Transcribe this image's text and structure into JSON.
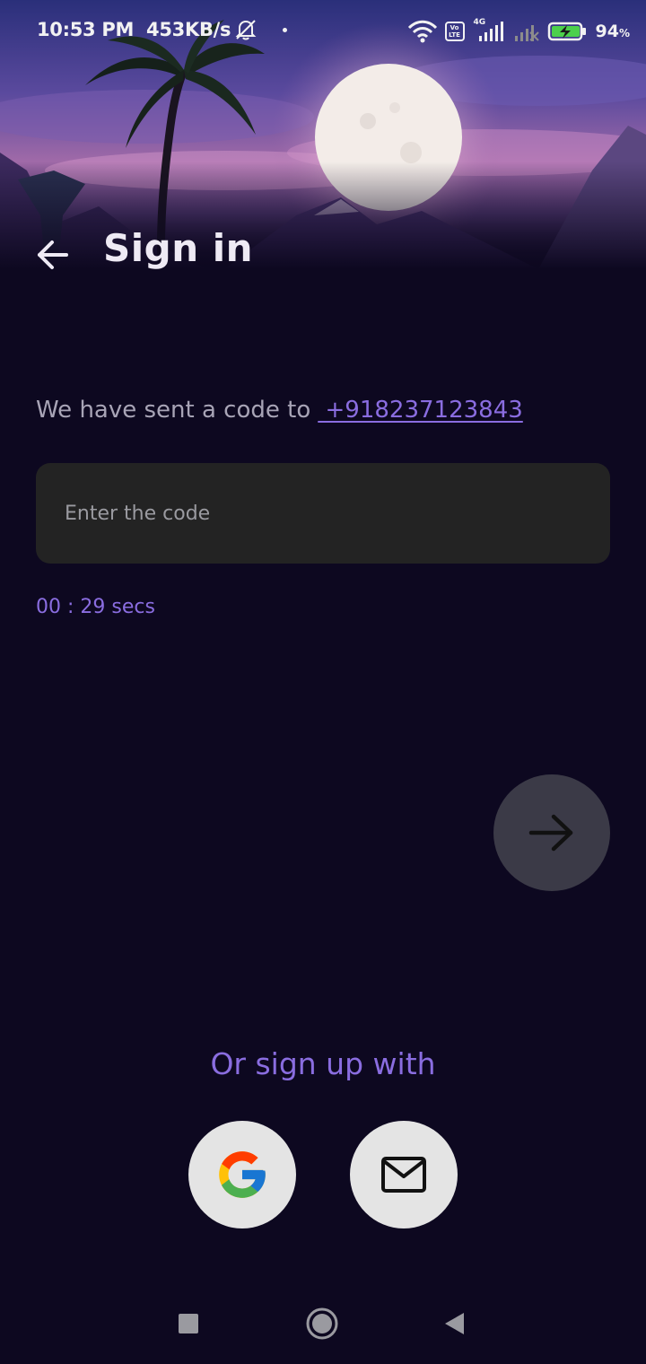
{
  "status_bar": {
    "time": "10:53 PM",
    "net_speed": "453KB/s",
    "battery_level": "94",
    "battery_unit": "%",
    "volte_label": "Vo LTE",
    "network_label": "4G",
    "icons": [
      "bell-muted-icon",
      "dot-icon",
      "wifi-icon",
      "volte-icon",
      "signal-4g-icon",
      "signal-empty-icon",
      "battery-charging-icon"
    ]
  },
  "header": {
    "back_icon": "arrow-left-icon",
    "title": "Sign in"
  },
  "verification": {
    "sent_text": "We have sent a code to",
    "phone": " +918237123843",
    "input_placeholder": "Enter the code",
    "input_value": "",
    "timer": "00 : 29 secs"
  },
  "next_button": {
    "icon": "arrow-right-icon"
  },
  "alt_signup": {
    "label": "Or sign up with",
    "options": [
      {
        "name": "Google",
        "icon": "google-icon"
      },
      {
        "name": "Email",
        "icon": "mail-icon"
      }
    ]
  },
  "nav_bar": {
    "icons": [
      "recents-square-icon",
      "home-circle-icon",
      "back-triangle-icon"
    ]
  },
  "colors": {
    "background": "#0d0820",
    "accent": "#8a6de0",
    "input_bg": "#232323",
    "next_button_bg": "#3b3a47",
    "social_button_bg": "#e4e4e4"
  }
}
